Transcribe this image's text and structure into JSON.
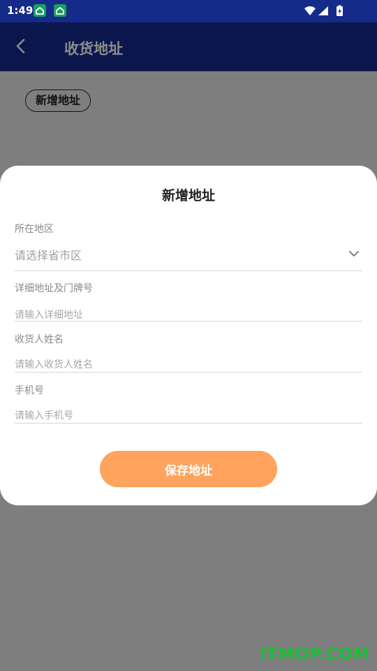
{
  "status_bar": {
    "time": "1:49",
    "notification_icons": [
      "home-notification-icon",
      "home-notification-icon"
    ],
    "system_icons": [
      "wifi-icon",
      "signal-icon",
      "battery-charging-icon"
    ]
  },
  "app_bar": {
    "back_icon": "chevron-left-icon",
    "title": "收货地址"
  },
  "content": {
    "add_address_button": "新增地址"
  },
  "sheet": {
    "title": "新增地址",
    "region": {
      "label": "所在地区",
      "placeholder": "请选择省市区"
    },
    "detail_address": {
      "label": "详细地址及门牌号",
      "placeholder": "请输入详细地址"
    },
    "receiver_name": {
      "label": "收货人姓名",
      "placeholder": "请输入收货人姓名"
    },
    "phone": {
      "label": "手机号",
      "placeholder": "请输入手机号"
    },
    "save_button": "保存地址"
  },
  "watermark": "ITMOP.COM",
  "colors": {
    "app_bar": "#152b8a",
    "save_button": "#ffa35e",
    "watermark": "#1dbf3a"
  }
}
